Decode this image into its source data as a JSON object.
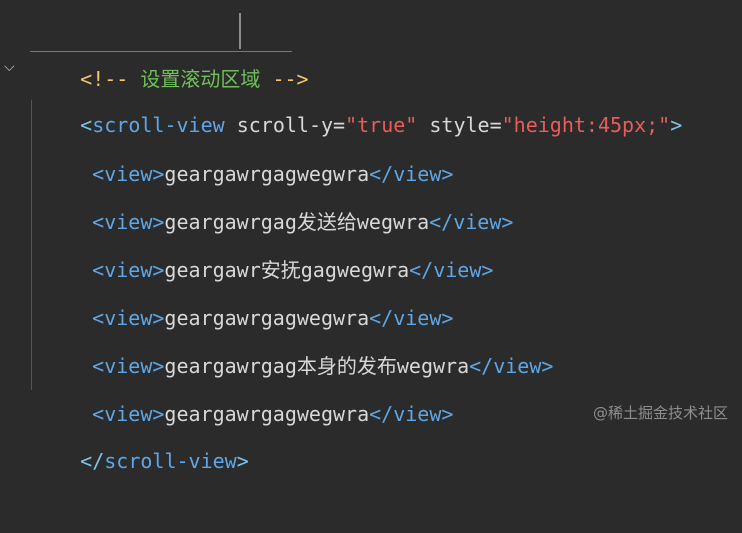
{
  "code": {
    "comment": {
      "open": "<!--",
      "text": " 设置滚动区域 ",
      "close": "-->"
    },
    "scroll_open": {
      "bracket_open": "<",
      "tag": "scroll-view",
      "attr1": " scroll-y=",
      "attr1_value": "\"true\"",
      "attr2": " style=",
      "attr2_value": "\"height:45px;\"",
      "bracket_close": ">"
    },
    "rows": [
      {
        "open": "<view>",
        "text": "geargawrgagwegwra",
        "close": "</view>"
      },
      {
        "open": "<view>",
        "text": "geargawrgag发送给wegwra",
        "close": "</view>"
      },
      {
        "open": "<view>",
        "text": "geargawr安抚gagwegwra",
        "close": "</view>"
      },
      {
        "open": "<view>",
        "text": "geargawrgagwegwra",
        "close": "</view>"
      },
      {
        "open": "<view>",
        "text": "geargawrgag本身的发布wegwra",
        "close": "</view>"
      },
      {
        "open": "<view>",
        "text": "geargawrgagwegwra",
        "close": "</view>"
      }
    ],
    "scroll_close": {
      "bracket_open": "</",
      "tag": "scroll-view",
      "bracket_close": ">"
    }
  },
  "gutter": {
    "fold_icon": "chevron-down-icon",
    "fold_glyph": "⌵"
  },
  "watermark": "@稀土掘金技术社区",
  "colors": {
    "background": "#2b2b2b",
    "comment_delim": "#f2c76f",
    "comment_text": "#6fbf5a",
    "tag": "#5ea6e6",
    "value": "#e85c5c"
  }
}
